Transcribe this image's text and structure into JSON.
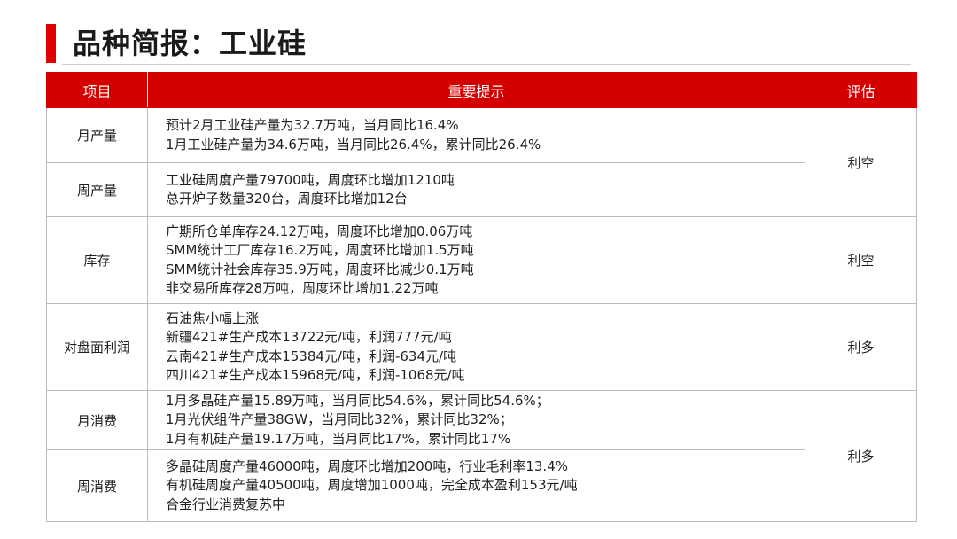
{
  "title": "品种简报：工业硅",
  "table": {
    "headers": [
      "项目",
      "重要提示",
      "评估"
    ],
    "rows": [
      {
        "item": "月产量",
        "tips": [
          "预计2月工业硅产量为32.7万吨，当月同比16.4%",
          "1月工业硅产量为34.6万吨，当月同比26.4%，累计同比26.4%"
        ]
      },
      {
        "item": "周产量",
        "tips": [
          "工业硅周度产量79700吨，周度环比增加1210吨",
          "总开炉子数量320台，周度环比增加12台"
        ]
      },
      {
        "item": "库存",
        "tips": [
          "广期所仓单库存24.12万吨，周度环比增加0.06万吨",
          "SMM统计工厂库存16.2万吨，周度环比增加1.5万吨",
          "SMM统计社会库存35.9万吨，周度环比减少0.1万吨",
          "非交易所库存28万吨，周度环比增加1.22万吨"
        ]
      },
      {
        "item": "对盘面利润",
        "tips": [
          "石油焦小幅上涨",
          "新疆421#生产成本13722元/吨，利润777元/吨",
          "云南421#生产成本15384元/吨，利润-634元/吨",
          "四川421#生产成本15968元/吨，利润-1068元/吨"
        ]
      },
      {
        "item": "月消费",
        "tips": [
          "1月多晶硅产量15.89万吨，当月同比54.6%，累计同比54.6%；",
          "1月光伏组件产量38GW，当月同比32%，累计同比32%；",
          "1月有机硅产量19.17万吨，当月同比17%，累计同比17%"
        ]
      },
      {
        "item": "周消费",
        "tips": [
          "多晶硅周度产量46000吨，周度环比增加200吨，行业毛利率13.4%",
          "有机硅周度产量40500吨，周度增加1000吨，完全成本盈利153元/吨",
          "合金行业消费复苏中"
        ]
      }
    ],
    "evaluations": [
      "利空",
      "利空",
      "利多",
      "利多"
    ]
  },
  "colors": {
    "accent": "#d40000",
    "title_bar": "#e00000",
    "border": "#bdbdbd"
  }
}
